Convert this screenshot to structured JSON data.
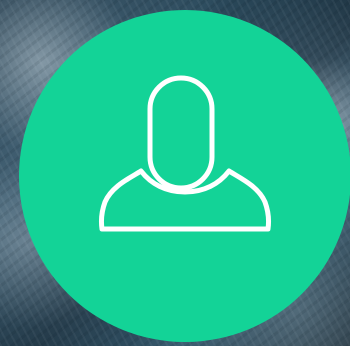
{
  "avatar": {
    "icon": "user-icon",
    "background_color": "#13d397",
    "icon_color": "#ffffff"
  },
  "background": {
    "description_colors": [
      "#1c3444",
      "#2b4a5c",
      "#d2e1eb"
    ]
  }
}
